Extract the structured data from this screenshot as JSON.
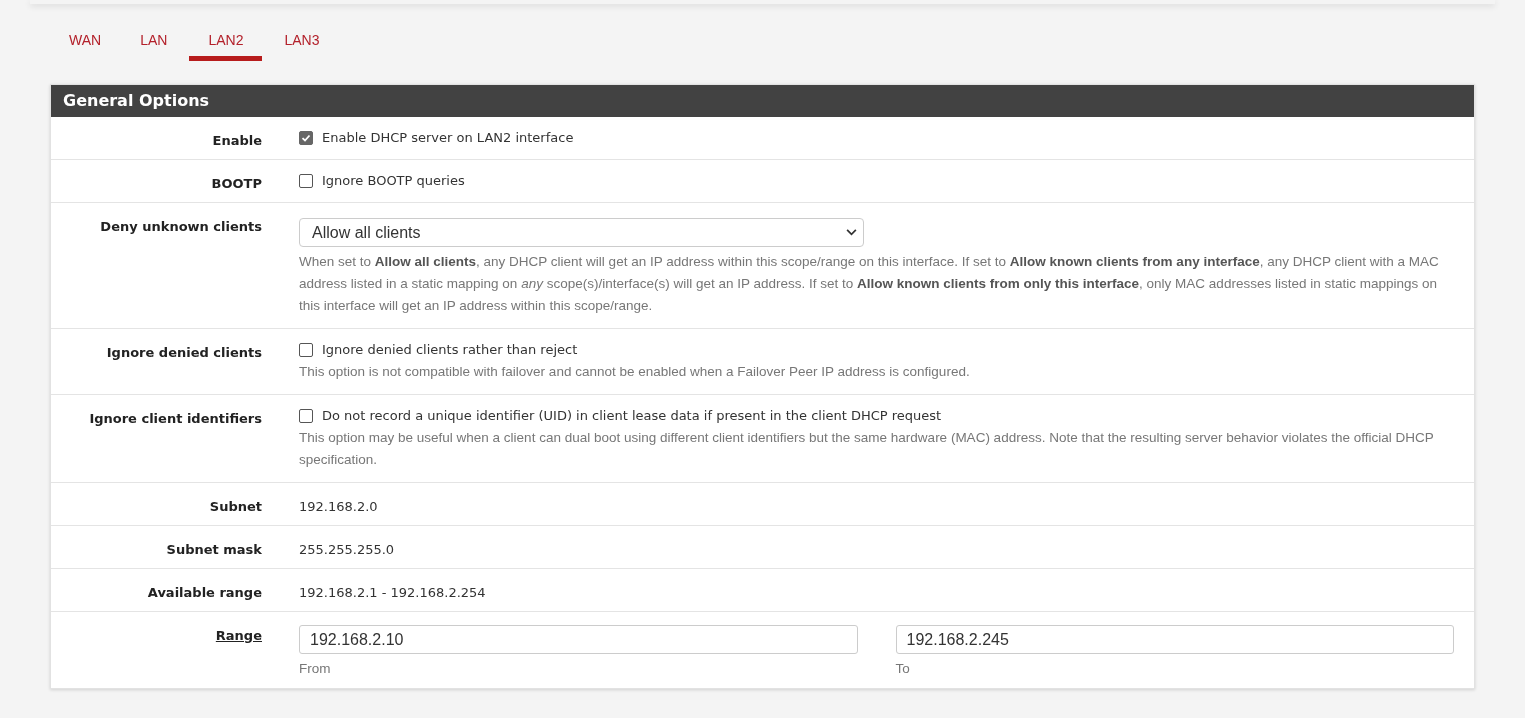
{
  "tabs": [
    {
      "label": "WAN",
      "selected": false
    },
    {
      "label": "LAN",
      "selected": false
    },
    {
      "label": "LAN2",
      "selected": true
    },
    {
      "label": "LAN3",
      "selected": false
    }
  ],
  "panel": {
    "title": "General Options",
    "rows": [
      {
        "kind": "checkbox",
        "label": "Enable",
        "checked": true,
        "text": "Enable DHCP server on LAN2 interface"
      },
      {
        "kind": "checkbox",
        "label": "BOOTP",
        "checked": false,
        "text": "Ignore BOOTP queries"
      },
      {
        "kind": "select",
        "label": "Deny unknown clients",
        "value": "Allow all clients",
        "help": "When set to **Allow all clients**, any DHCP client will get an IP address within this scope/range on this interface. If set to **Allow known clients from any interface**, any DHCP client with a MAC address listed in a static mapping on *any* scope(s)/interface(s) will get an IP address. If set to **Allow known clients from only this interface**, only MAC addresses listed in static mappings on this interface will get an IP address within this scope/range."
      },
      {
        "kind": "checkbox",
        "label": "Ignore denied clients",
        "checked": false,
        "text": "Ignore denied clients rather than reject",
        "help": "This option is not compatible with failover and cannot be enabled when a Failover Peer IP address is configured."
      },
      {
        "kind": "checkbox",
        "label": "Ignore client identifiers",
        "checked": false,
        "text": "Do not record a unique identifier (UID) in client lease data if present in the client DHCP request",
        "help": "This option may be useful when a client can dual boot using different client identifiers but the same hardware (MAC) address. Note that the resulting server behavior violates the official DHCP specification."
      },
      {
        "kind": "static",
        "label": "Subnet",
        "value": "192.168.2.0"
      },
      {
        "kind": "static",
        "label": "Subnet mask",
        "value": "255.255.255.0"
      },
      {
        "kind": "static",
        "label": "Available range",
        "value": "192.168.2.1 - 192.168.2.254"
      },
      {
        "kind": "range",
        "label": "Range",
        "from": {
          "value": "192.168.2.10",
          "caption": "From"
        },
        "to": {
          "value": "192.168.2.245",
          "caption": "To"
        }
      }
    ]
  }
}
